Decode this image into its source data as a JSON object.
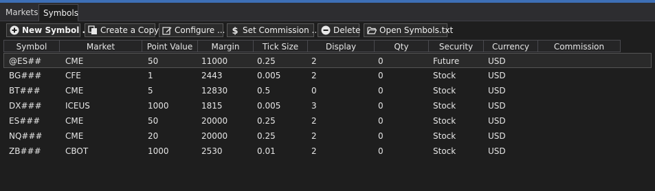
{
  "tabs": [
    "Markets",
    "Symbols"
  ],
  "toolbar": {
    "new_symbol": "New Symbol ...",
    "create_copy": "Create a Copy",
    "configure": "Configure ...",
    "set_commission": "Set Commission ...",
    "delete": "Delete",
    "open_file": "Open Symbols.txt"
  },
  "columns": [
    "Symbol",
    "Market",
    "Point Value",
    "Margin",
    "Tick Size",
    "Display Decimals",
    "Qty Decimals",
    "Security Type",
    "Currency",
    "Commission"
  ],
  "rows": [
    [
      "@ES##",
      "CME",
      "50",
      "11000",
      "0.25",
      "2",
      "0",
      "Future",
      "USD",
      ""
    ],
    [
      "BG###",
      "CFE",
      "1",
      "2443",
      "0.005",
      "2",
      "0",
      "Stock",
      "USD",
      ""
    ],
    [
      "BT###",
      "CME",
      "5",
      "12830",
      "0.5",
      "0",
      "0",
      "Stock",
      "USD",
      ""
    ],
    [
      "DX###",
      "ICEUS",
      "1000",
      "1815",
      "0.005",
      "3",
      "0",
      "Stock",
      "USD",
      ""
    ],
    [
      "ES###",
      "CME",
      "50",
      "20000",
      "0.25",
      "2",
      "0",
      "Stock",
      "USD",
      ""
    ],
    [
      "NQ###",
      "CME",
      "20",
      "20000",
      "0.25",
      "2",
      "0",
      "Stock",
      "USD",
      ""
    ],
    [
      "ZB###",
      "CBOT",
      "1000",
      "2530",
      "0.01",
      "2",
      "0",
      "Stock",
      "USD",
      ""
    ]
  ],
  "colors": {
    "accent": "#3d6fb6",
    "background": "#1e1e1e",
    "header_bg": "#252526"
  }
}
